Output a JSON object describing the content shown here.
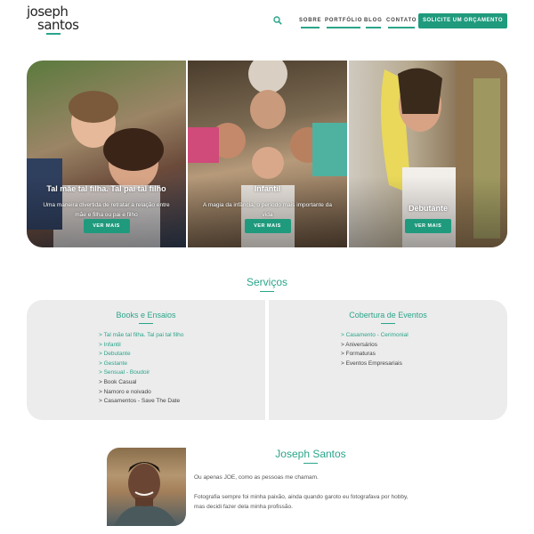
{
  "logo": {
    "line1": "joseph",
    "line2": "santos"
  },
  "nav": {
    "items": [
      "SOBRE",
      "PORTFÓLIO",
      "BLOG",
      "CONTATO"
    ],
    "cta": "SOLICITE UM ORÇAMENTO",
    "search_icon": "search-icon",
    "accent": "#2aa58a"
  },
  "hero": {
    "cards": [
      {
        "title": "Tal mãe tal filha. Tal pai tal filho",
        "desc": "Uma maneira divertida de retratar a relação entre mãe e filha ou pai e filho",
        "button": "VER MAIS"
      },
      {
        "title": "Infantil",
        "desc": "A magia da infância, o período mais importante da vida",
        "button": "VER MAIS"
      },
      {
        "title": "Debutante",
        "desc": "",
        "button": "VER MAIS"
      }
    ]
  },
  "services": {
    "title": "Serviços",
    "books": {
      "title": "Books e Ensaios",
      "items": [
        "> Tal mãe tal filha. Tal pai tal filho",
        "> Infantil",
        "> Debutante",
        "> Gestante",
        "> Sensual - Boudoir",
        "> Book Casual",
        "> Namoro e noivado",
        "> Casamentos - Save The Date"
      ]
    },
    "eventos": {
      "title": "Cobertura de Eventos",
      "items": [
        "> Casamento - Cerimonial",
        "> Aniversários",
        "> Formaturas",
        "> Eventos Empresariais"
      ]
    }
  },
  "about": {
    "name": "Joseph Santos",
    "p1": "Ou apenas JOE, como as pessoas me chamam.",
    "p2a": "Fotografia sempre foi minha paixão, ainda quando garoto eu fotografava por hobby,",
    "p2b": "mas decidi fazer dela minha profissão."
  }
}
